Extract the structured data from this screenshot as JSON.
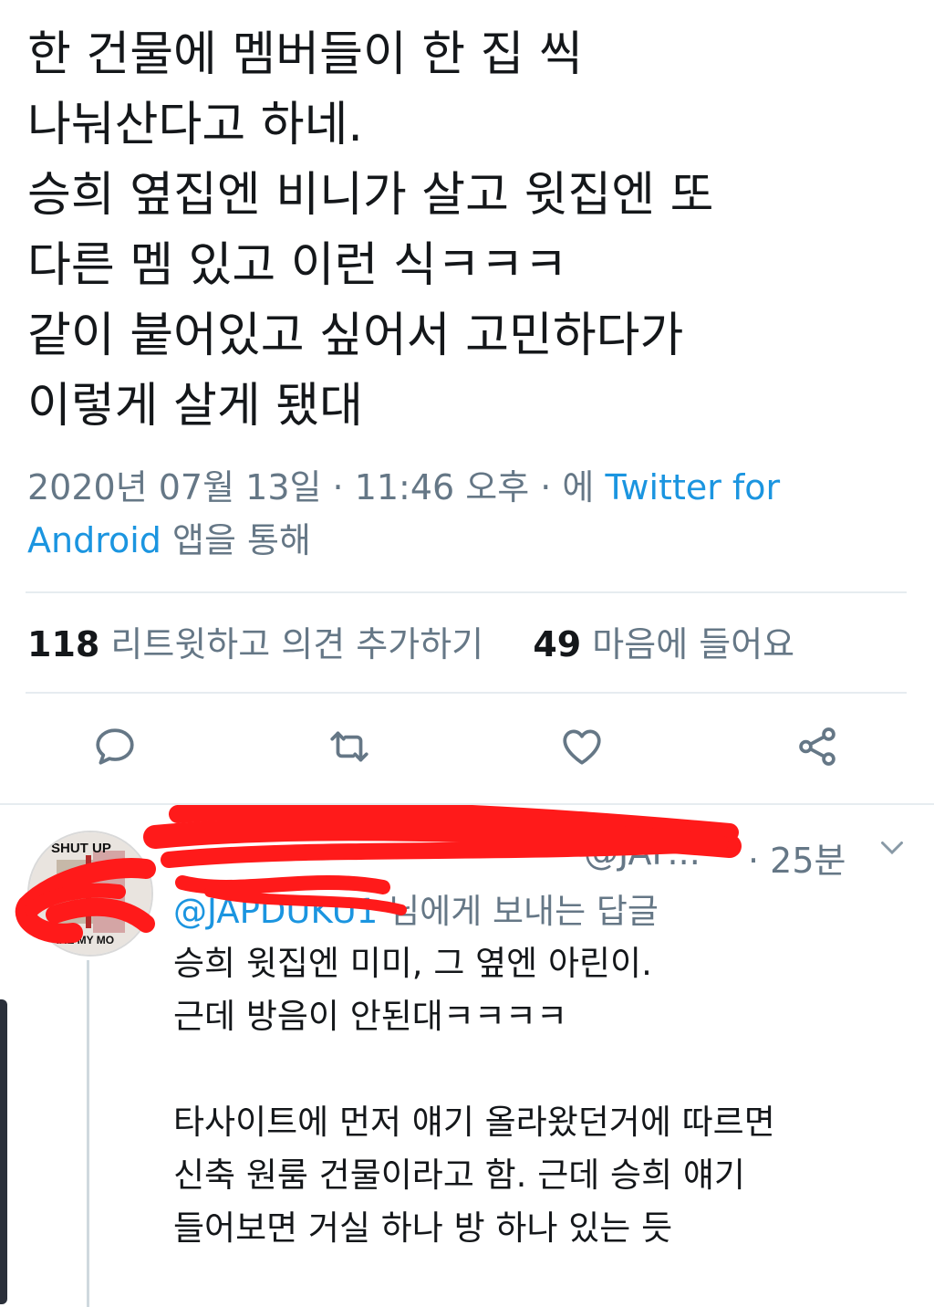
{
  "tweet": {
    "lines": [
      "한 건물에 멤버들이 한 집 씩",
      "나눠산다고 하네.",
      "승희 옆집엔 비니가 살고 윗집엔 또",
      "다른 멤 있고 이런 식ㅋㅋㅋ",
      "같이 붙어있고 싶어서 고민하다가",
      "이렇게 살게 됐대"
    ],
    "meta_line1_prefix": "2020년 07월 13일 · 11:46 오후 · 에 ",
    "meta_link_part1": "Twitter for",
    "meta_link_part2": "Android",
    "meta_line2_suffix": " 앱을 통해"
  },
  "stats": {
    "retweets_count": "118",
    "retweets_label": " 리트윗하고 의견 추가하기",
    "likes_count": "49",
    "likes_label": " 마음에 들어요"
  },
  "actions": {
    "icons": [
      "reply-icon",
      "retweet-icon",
      "like-icon",
      "share-icon"
    ]
  },
  "reply": {
    "avatar_text_top": "SHUT UP",
    "avatar_text_bottom": "AKE MY MO",
    "handle_tail": "@JAP...",
    "time": "· 25분",
    "reply_to_handle": "@JAPDUKU1",
    "reply_to_suffix": " 님에게 보내는 답글",
    "lines": [
      "승희 윗집엔 미미, 그 옆엔 아린이.",
      "근데 방음이 안된대ㅋㅋㅋㅋ",
      "",
      "타사이트에 먼저 얘기 올라왔던거에 따르면",
      "신축 원룸 건물이라고 함. 근데 승희 얘기",
      "들어보면 거실 하나 방 하나 있는 듯"
    ]
  },
  "colors": {
    "text": "#14171a",
    "secondary": "#657786",
    "link": "#1b95e0",
    "divider": "#e6ecf0",
    "redaction": "#ff1a1a"
  }
}
